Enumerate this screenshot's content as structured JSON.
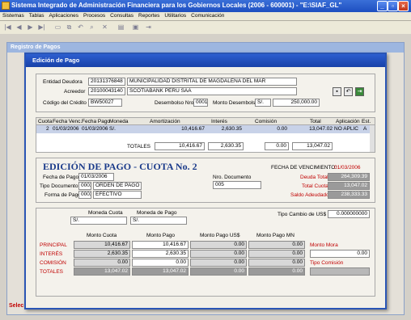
{
  "app": {
    "title": "Sistema Integrado de Administración Financiera para los Gobiernos Locales (2006 - 600001) - \"E:\\SIAF_GL\""
  },
  "menu": [
    "Sistemas",
    "Tablas",
    "Aplicaciones",
    "Procesos",
    "Consultas",
    "Reportes",
    "Utilitarios",
    "Comunicación"
  ],
  "background_window": {
    "title": "Registro de Pagos",
    "label_prefix": "Selec"
  },
  "dialog": {
    "title": "Edición de Pago",
    "entity": {
      "deudora_label": "Entidad Deudora",
      "deudora_code": "20131376848",
      "deudora_name": "MUNICIPALIDAD DISTRITAL DE MAGDALENA DEL MAR",
      "acreedor_label": "Acreedor",
      "acreedor_code": "20100043140",
      "acreedor_name": "SCOTIABANK PERU SAA",
      "codigo_label": "Código del Crédito",
      "codigo": "BW50027",
      "desembolso_label": "Desembolso Nro.",
      "desembolso": "0001",
      "monto_label": "Monto Desembolso",
      "monto_currency": "S/.",
      "monto": "250,000.00"
    },
    "grid": {
      "headers": [
        "Cuota",
        "Fecha Venc.",
        "Fecha Pago",
        "Moneda",
        "Amortización",
        "Interés",
        "Comisión",
        "Total",
        "Aplicación",
        "Est."
      ],
      "row": [
        "2",
        "01/03/2006",
        "01/03/2006",
        "S/.",
        "10,416.67",
        "2,630.35",
        "0.00",
        "13,047.02",
        "NO APLIC",
        "A"
      ],
      "totals_label": "TOTALES",
      "totals": [
        "10,416.67",
        "2,630.35",
        "0.00",
        "13,047.02"
      ]
    },
    "edit": {
      "heading": "EDICIÓN DE PAGO - CUOTA No. 2",
      "venc_label": "FECHA DE VENCIMIENTO:",
      "venc_date": "01/03/2006",
      "fecha_label": "Fecha de Pago",
      "fecha": "01/03/2006",
      "nrodoc_label": "Nro. Documento",
      "nrodoc": "005",
      "tipodoc_label": "Tipo Documento",
      "tipodoc_code": "0003",
      "tipodoc_name": "ORDEN DE PAGO",
      "forma_label": "Forma de Pago",
      "forma_code": "0003",
      "forma_name": "EFECTIVO",
      "deuda_total_label": "Deuda Total",
      "deuda_total": "264,309.39",
      "total_cuota_label": "Total Cuota",
      "total_cuota": "13,047.02",
      "saldo_label": "Saldo Adeudado",
      "saldo": "238,333.33"
    },
    "currency": {
      "moneda_cuota_label": "Moneda Cuota",
      "moneda_cuota": "S/.",
      "moneda_pago_label": "Moneda de Pago",
      "moneda_pago": "S/.",
      "tipo_cambio_label": "Tipo Cambio de US$",
      "tipo_cambio": "0.000000000"
    },
    "amounts": {
      "headers": [
        "Monto Cuota",
        "Monto Pago",
        "Monto Pago US$",
        "Monto Pago MN"
      ],
      "rows": [
        {
          "label": "PRINCIPAL",
          "values": [
            "10,416.67",
            "10,416.67",
            "0.00",
            "0.00"
          ]
        },
        {
          "label": "INTERÉS",
          "values": [
            "2,630.35",
            "2,630.35",
            "0.00",
            "0.00"
          ]
        },
        {
          "label": "COMISIÓN",
          "values": [
            "0.00",
            "0.00",
            "0.00",
            "0.00"
          ]
        },
        {
          "label": "TOTALES",
          "values": [
            "13,047.02",
            "13,047.02",
            "0.00",
            "0.00"
          ]
        }
      ],
      "mora_label": "Monto Mora",
      "mora": "0.00",
      "tipo_comision_label": "Tipo Comisión"
    }
  }
}
